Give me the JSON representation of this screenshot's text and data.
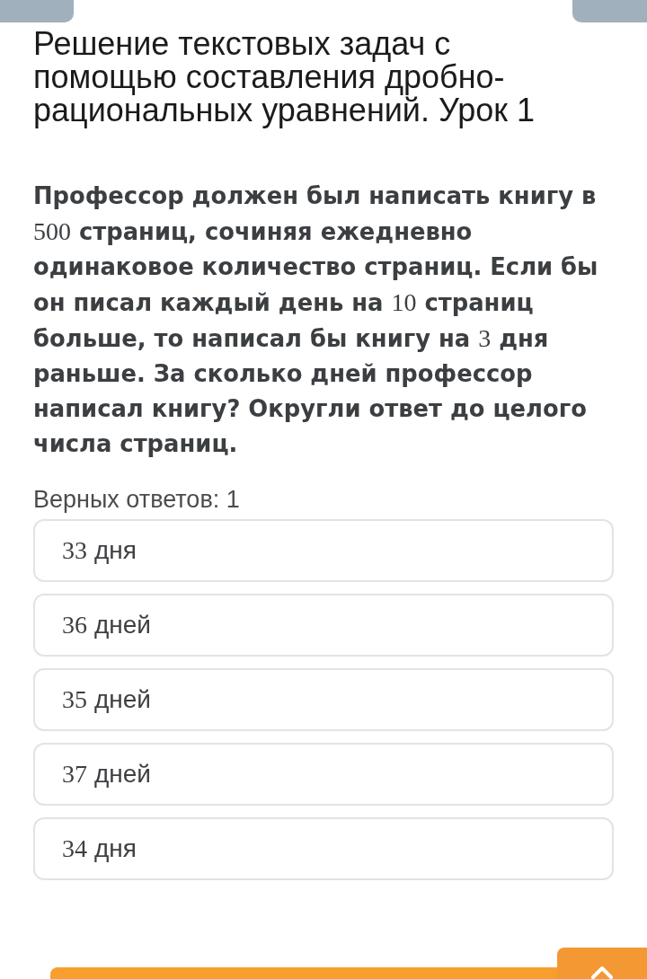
{
  "title": "Решение текстовых задач с помощью составления дробно-рациональных уравнений. Урок 1",
  "question": [
    {
      "kind": "text",
      "text": "Профессор должен был написать книгу в "
    },
    {
      "kind": "math",
      "text": "500"
    },
    {
      "kind": "text",
      "text": " страниц, сочиняя ежедневно одинаковое количество страниц. Если бы он писал каждый день на "
    },
    {
      "kind": "math",
      "text": "10"
    },
    {
      "kind": "text",
      "text": " страниц больше, то написал бы книгу на "
    },
    {
      "kind": "math",
      "text": "3"
    },
    {
      "kind": "text",
      "text": " дня раньше. За сколько дней профессор написал книгу? Округли ответ до целого числа страниц."
    }
  ],
  "correct_count": "Верных ответов: 1",
  "answers": [
    {
      "number": "33",
      "unit": "дня",
      "selected": false
    },
    {
      "number": "36",
      "unit": "дней",
      "selected": false
    },
    {
      "number": "35",
      "unit": "дней",
      "selected": false
    },
    {
      "number": "37",
      "unit": "дней",
      "selected": false
    },
    {
      "number": "34",
      "unit": "дня",
      "selected": false
    }
  ]
}
